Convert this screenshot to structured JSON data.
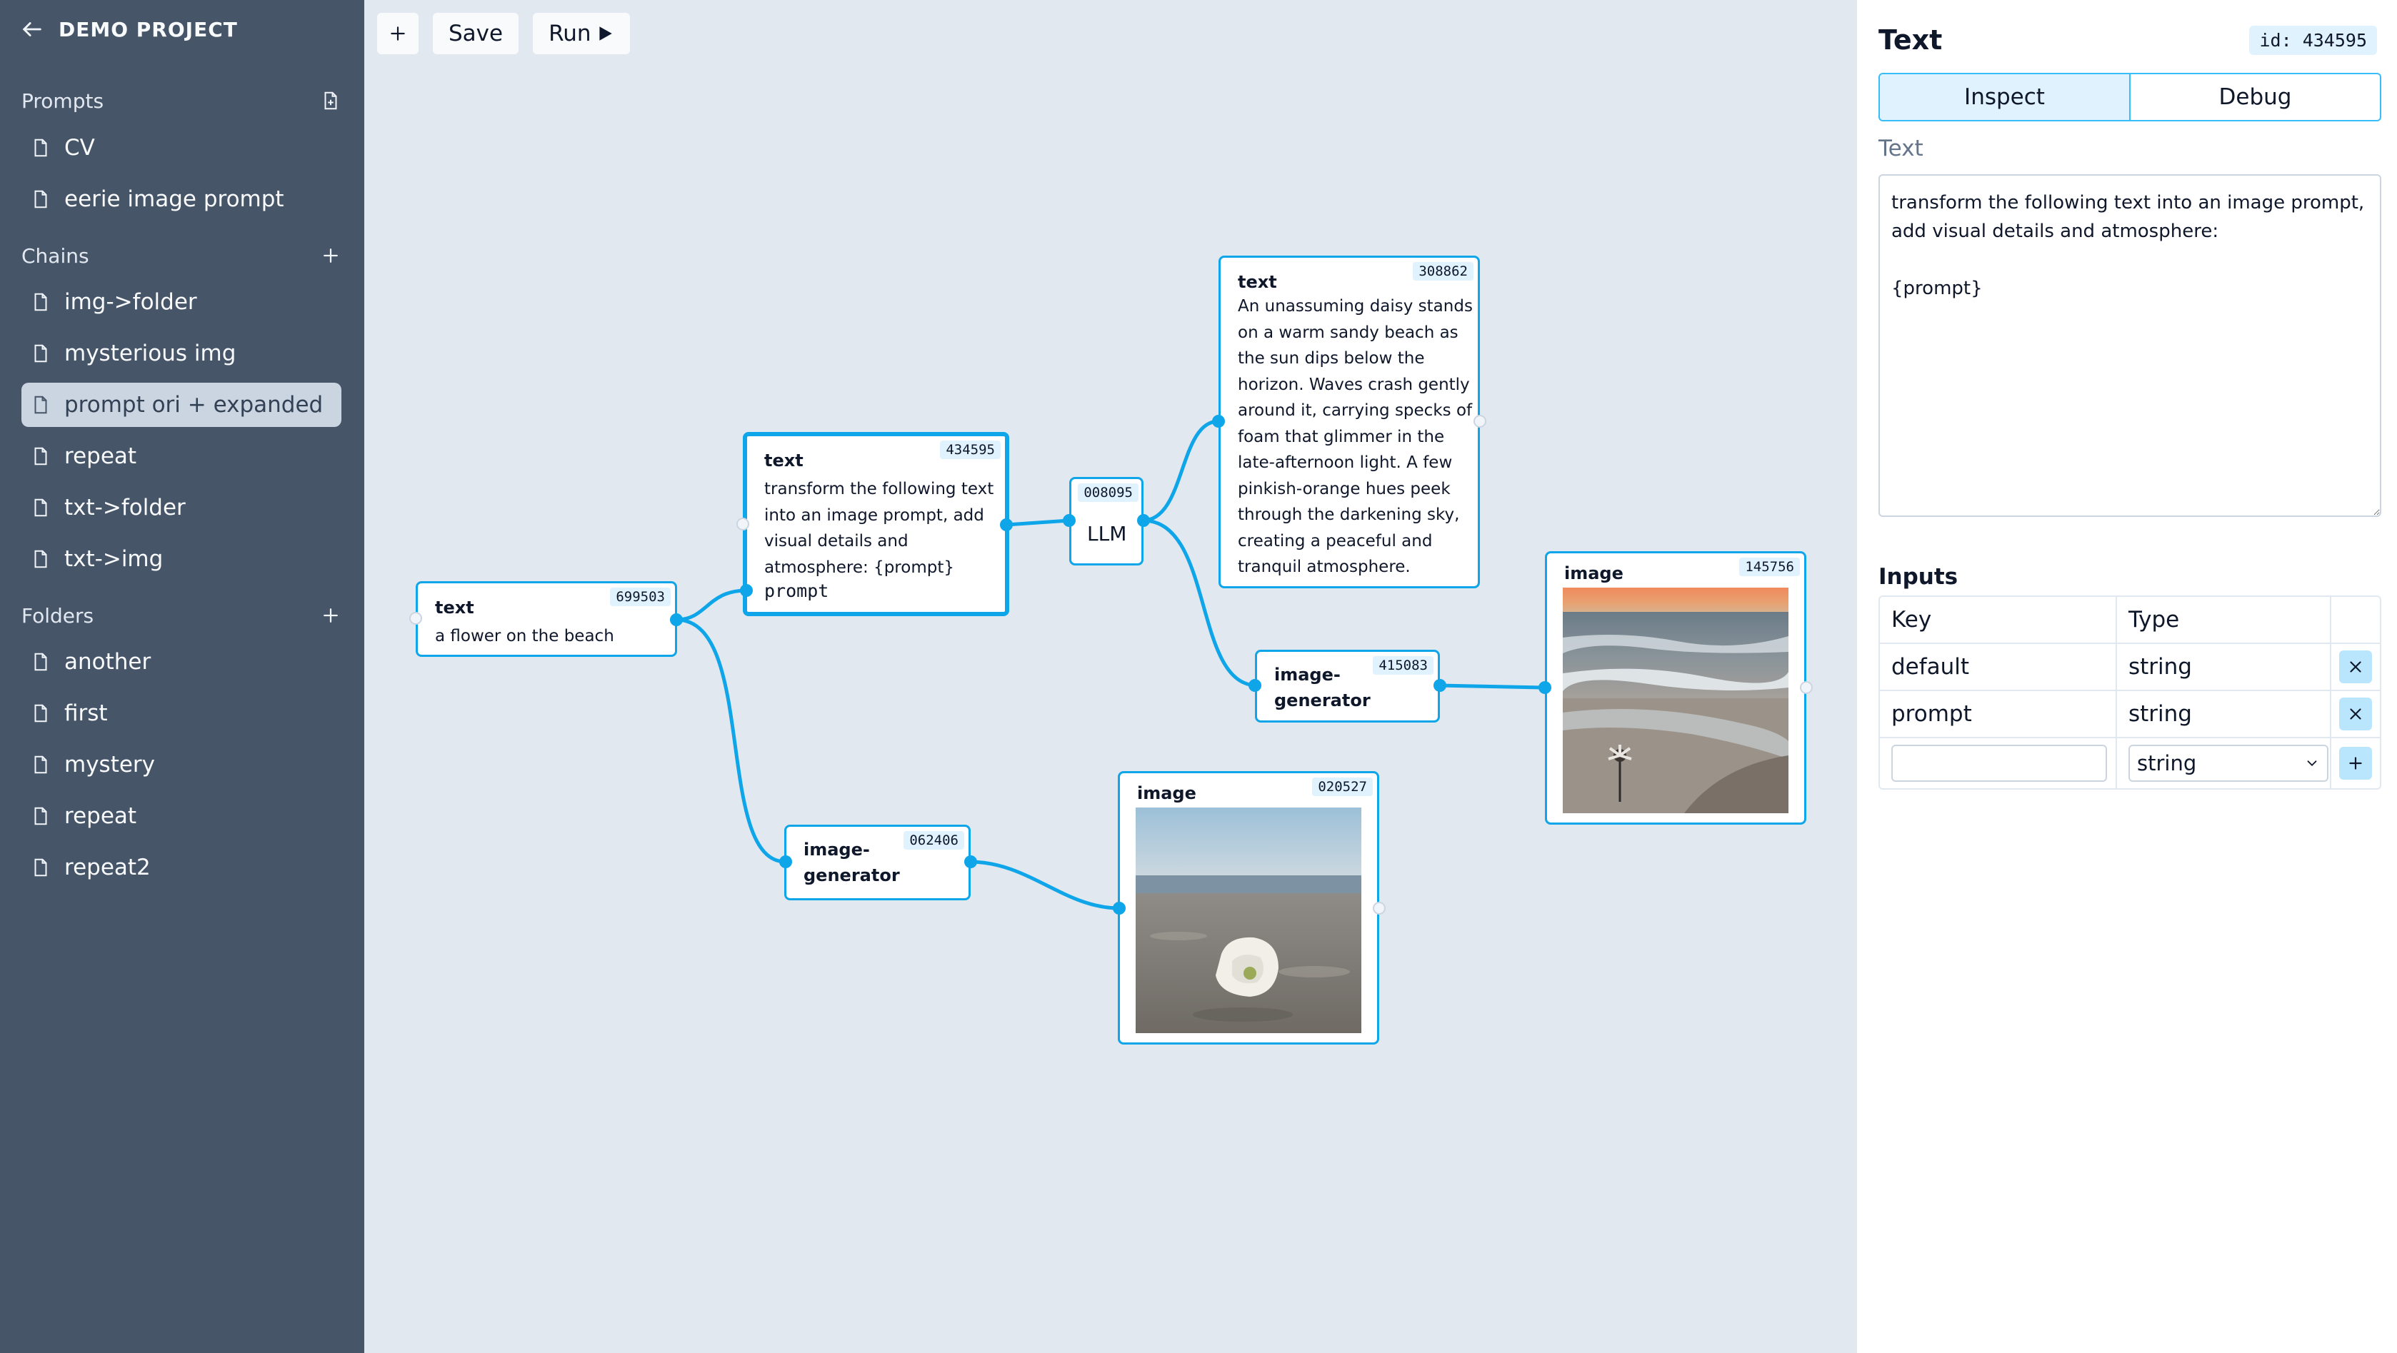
{
  "sidebar": {
    "title": "DEMO PROJECT",
    "sections": [
      {
        "title": "Prompts",
        "items": [
          "CV",
          "eerie image prompt"
        ]
      },
      {
        "title": "Chains",
        "items": [
          "img->folder",
          "mysterious img",
          "prompt ori + expanded",
          "repeat",
          "txt->folder",
          "txt->img"
        ]
      },
      {
        "title": "Folders",
        "items": [
          "another",
          "first",
          "mystery",
          "repeat",
          "repeat2"
        ]
      }
    ],
    "active_item": "prompt ori + expanded"
  },
  "toolbar": {
    "save_label": "Save",
    "run_label": "Run"
  },
  "nodes": {
    "text_699503": {
      "type": "text",
      "id": "699503",
      "body": "a flower on the beach"
    },
    "text_434595": {
      "type": "text",
      "id": "434595",
      "lines": [
        "transform the following text",
        "into an image prompt, add",
        "visual details and",
        "atmosphere: {prompt}"
      ],
      "port": "prompt"
    },
    "llm_008095": {
      "type": "LLM",
      "id": "008095"
    },
    "text_308862": {
      "type": "text",
      "id": "308862",
      "lines": [
        "An unassuming daisy stands",
        "on a warm sandy beach as",
        "the sun dips below the",
        "horizon. Waves crash gently",
        "around it, carrying specks of",
        "foam that glimmer in the",
        "late-afternoon light. A few",
        "pinkish-orange hues peek",
        "through the darkening sky,",
        "creating a peaceful and",
        "tranquil atmosphere."
      ]
    },
    "imggen_415083": {
      "type": "image-generator",
      "lines": [
        "image-",
        "generator"
      ],
      "id": "415083"
    },
    "image_145756": {
      "type": "image",
      "id": "145756"
    },
    "imggen_062406": {
      "type": "image-generator",
      "lines": [
        "image-",
        "generator"
      ],
      "id": "062406"
    },
    "image_020527": {
      "type": "image",
      "id": "020527"
    }
  },
  "panel": {
    "title": "Text",
    "id_badge": "id: 434595",
    "tabs": [
      "Inspect",
      "Debug"
    ],
    "field_label": "Text",
    "text_value": "transform the following text into an image prompt, add visual details and atmosphere:\n\n{prompt}",
    "inputs_title": "Inputs",
    "columns": [
      "Key",
      "Type"
    ],
    "rows": [
      {
        "key": "default",
        "type": "string"
      },
      {
        "key": "prompt",
        "type": "string"
      }
    ],
    "new_row_type": "string"
  },
  "colors": {
    "accent": "#0ea5e9",
    "sidebar_bg": "#475569",
    "canvas_bg": "#e2e8f0"
  }
}
